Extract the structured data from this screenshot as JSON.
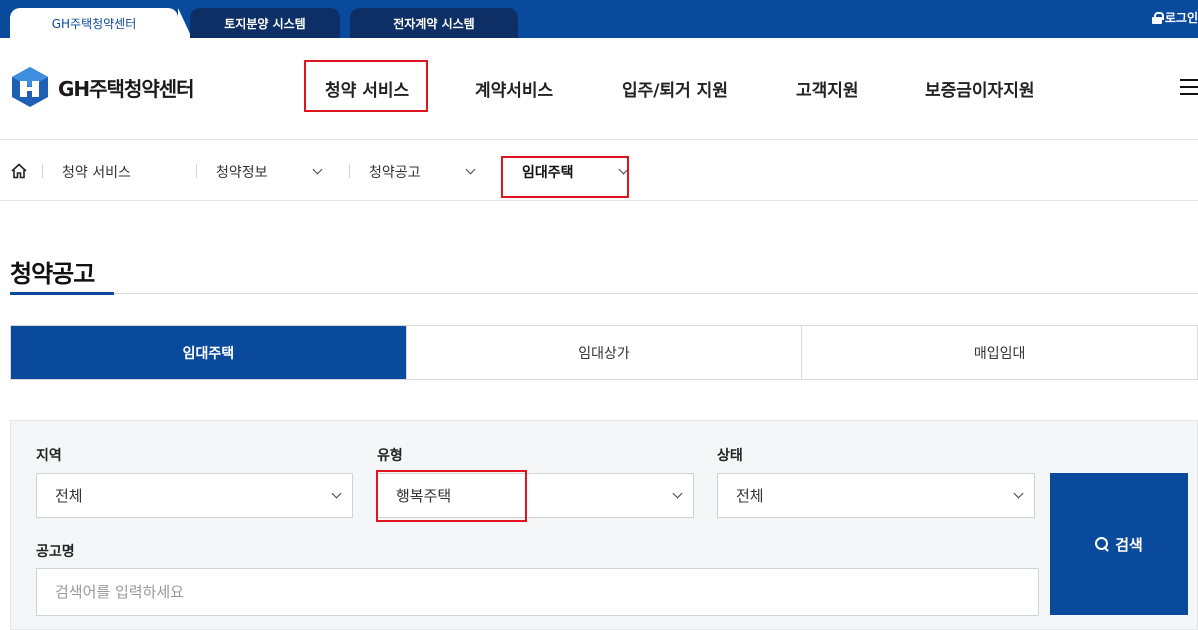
{
  "top_tabs": [
    {
      "label": "GH주택청약센터"
    },
    {
      "label": "토지분양 시스템"
    },
    {
      "label": "전자계약 시스템"
    }
  ],
  "login_label": "로그인",
  "header": {
    "logo_text": "GH주택청약센터",
    "nav": [
      {
        "label": "청약 서비스"
      },
      {
        "label": "계약서비스"
      },
      {
        "label": "입주/퇴거 지원"
      },
      {
        "label": "고객지원"
      },
      {
        "label": "보증금이자지원"
      }
    ]
  },
  "breadcrumb": {
    "items": [
      {
        "label": "청약 서비스"
      },
      {
        "label": "청약정보"
      },
      {
        "label": "청약공고"
      },
      {
        "label": "임대주택"
      }
    ]
  },
  "page_title": "청약공고",
  "tabs": [
    {
      "label": "임대주택"
    },
    {
      "label": "임대상가"
    },
    {
      "label": "매입임대"
    }
  ],
  "search": {
    "region_label": "지역",
    "region_value": "전체",
    "type_label": "유형",
    "type_value": "행복주택",
    "status_label": "상태",
    "status_value": "전체",
    "name_label": "공고명",
    "name_placeholder": "검색어를 입력하세요",
    "button_label": "검색"
  },
  "colors": {
    "brand_blue": "#0a4a9c",
    "dark_blue": "#0d2f66",
    "highlight_red": "#e0141e"
  }
}
